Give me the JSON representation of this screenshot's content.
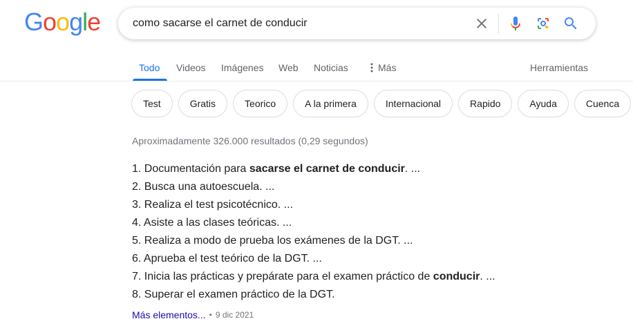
{
  "logo": {
    "letters": [
      "G",
      "o",
      "o",
      "g",
      "l",
      "e"
    ],
    "colors": [
      "#4285F4",
      "#EA4335",
      "#FBBC05",
      "#4285F4",
      "#34A853",
      "#EA4335"
    ]
  },
  "search": {
    "query": "como sacarse el carnet de conducir"
  },
  "icons": {
    "clear": "close-icon",
    "voice": "microphone-icon",
    "lens": "camera-lens-icon",
    "search": "search-icon",
    "more": "three-dots-vertical-icon"
  },
  "tabs": [
    {
      "label": "Todo",
      "active": true
    },
    {
      "label": "Videos"
    },
    {
      "label": "Imágenes"
    },
    {
      "label": "Web"
    },
    {
      "label": "Noticias"
    },
    {
      "label": "Más"
    }
  ],
  "tools_label": "Herramientas",
  "chips": [
    "Test",
    "Gratis",
    "Teorico",
    "A la primera",
    "Internacional",
    "Rapido",
    "Ayuda",
    "Cuenca"
  ],
  "result_stats": "Aproximadamente 326.000 resultados (0,29 segundos)",
  "list": [
    {
      "num": "1.",
      "pre": "Documentación para ",
      "bold": "sacarse el carnet de conducir",
      "post": ". ..."
    },
    {
      "num": "2.",
      "pre": "Busca una autoescuela. ...",
      "bold": "",
      "post": ""
    },
    {
      "num": "3.",
      "pre": "Realiza el test psicotécnico. ...",
      "bold": "",
      "post": ""
    },
    {
      "num": "4.",
      "pre": "Asiste a las clases teóricas. ...",
      "bold": "",
      "post": ""
    },
    {
      "num": "5.",
      "pre": "Realiza a modo de prueba los exámenes de la DGT. ...",
      "bold": "",
      "post": ""
    },
    {
      "num": "6.",
      "pre": "Aprueba el test teórico de la DGT. ...",
      "bold": "",
      "post": ""
    },
    {
      "num": "7.",
      "pre": "Inicia las prácticas y prepárate para el examen práctico de ",
      "bold": "conducir",
      "post": ". ..."
    },
    {
      "num": "8.",
      "pre": "Superar el examen práctico de la DGT.",
      "bold": "",
      "post": ""
    }
  ],
  "more": {
    "label": "Más elementos...",
    "separator": "•",
    "date": "9 dic 2021"
  },
  "colors": {
    "accent": "#1a73e8",
    "link": "#1a0dab",
    "muted": "#70757a"
  }
}
